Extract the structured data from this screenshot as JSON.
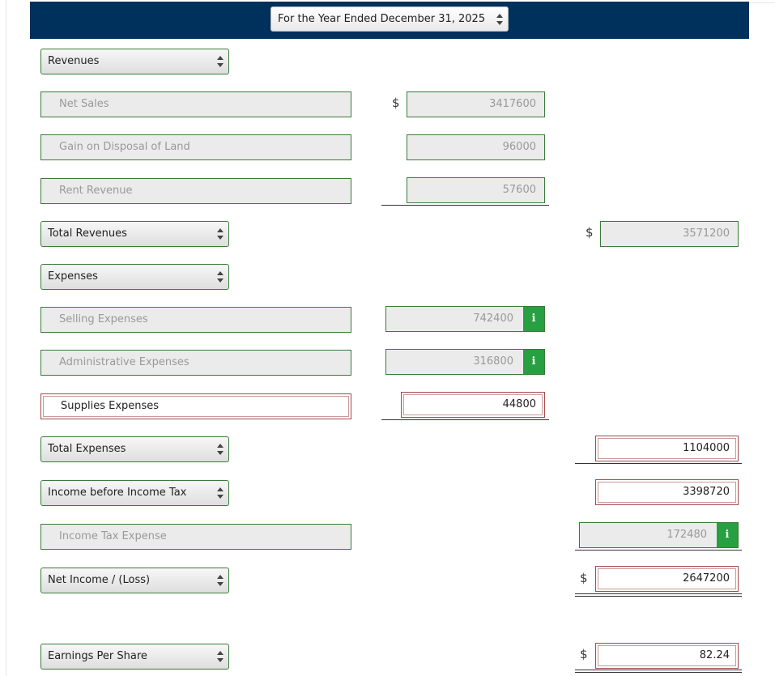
{
  "header": {
    "period": "For the Year Ended December 31, 2025"
  },
  "currency_symbol": "$",
  "sections": {
    "revenues_heading": "Revenues",
    "total_revenues": "Total Revenues",
    "expenses_heading": "Expenses",
    "total_expenses": "Total Expenses",
    "income_before_tax": "Income before Income Tax",
    "net_income": "Net Income / (Loss)",
    "eps": "Earnings Per Share"
  },
  "rows": {
    "net_sales": {
      "label": "Net Sales",
      "value": "3417600"
    },
    "gain_land": {
      "label": "Gain on Disposal of Land",
      "value": "96000"
    },
    "rent_revenue": {
      "label": "Rent Revenue",
      "value": "57600"
    },
    "total_revenues_value": "3571200",
    "selling_expenses": {
      "label": "Selling Expenses",
      "value": "742400"
    },
    "admin_expenses": {
      "label": "Administrative Expenses",
      "value": "316800"
    },
    "supplies_expenses": {
      "label": "Supplies Expenses",
      "value": "44800"
    },
    "total_expenses_value": "1104000",
    "income_before_tax_value": "3398720",
    "income_tax_expense": {
      "label": "Income Tax Expense",
      "value": "172480"
    },
    "net_income_value": "2647200",
    "eps_value": "82.24"
  },
  "info_icon_glyph": "i"
}
